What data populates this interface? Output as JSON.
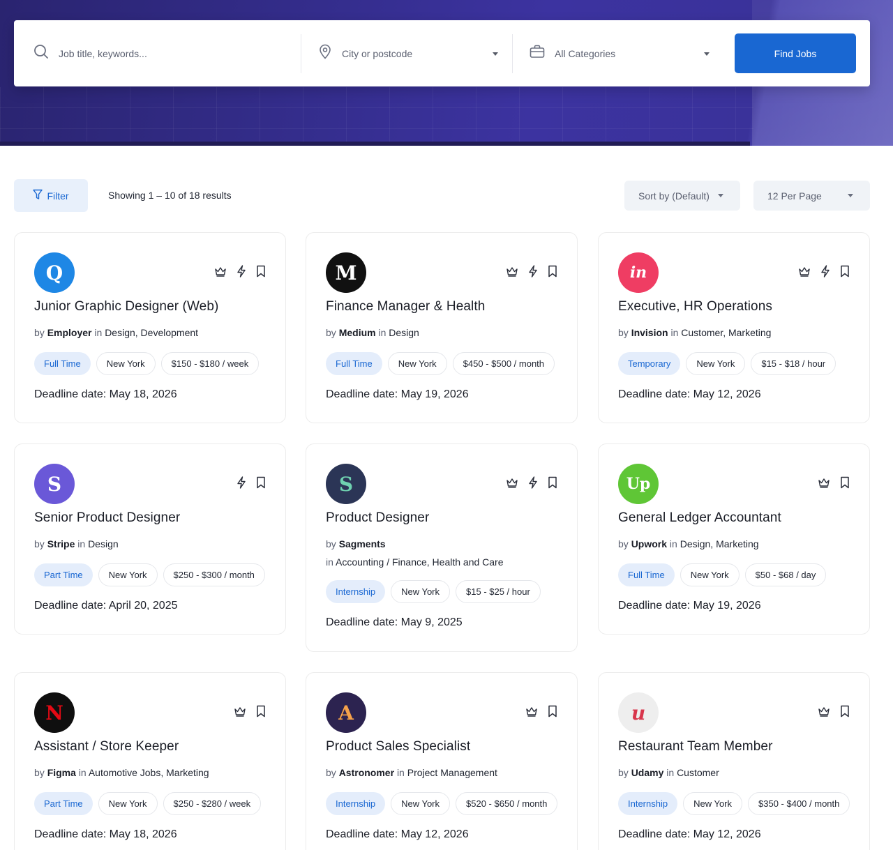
{
  "search": {
    "keyword_placeholder": "Job title, keywords...",
    "city_placeholder": "City or postcode",
    "category_value": "All Categories",
    "find_button": "Find Jobs"
  },
  "toolbar": {
    "filter_label": "Filter",
    "results_text": "Showing 1 – 10 of 18 results",
    "sort_value": "Sort by (Default)",
    "per_page_value": "12 Per Page"
  },
  "colors": {
    "accent": "#1967d2",
    "tag_bg": "#e4edfb"
  },
  "jobs": [
    {
      "title": "Junior Graphic Designer (Web)",
      "by_label": "by",
      "company": "Employer",
      "in_label": "in",
      "categories": "Design, Development",
      "type": "Full Time",
      "location": "New York",
      "salary": "$150 - $180 / week",
      "deadline": "Deadline date: May 18, 2026",
      "logo": {
        "icon": "employer-logo",
        "text": "Q",
        "bg": "#1e87e5",
        "color": "#ffffff"
      },
      "badges": [
        "crown-icon",
        "lightning-icon",
        "bookmark-icon"
      ]
    },
    {
      "title": "Finance Manager & Health",
      "by_label": "by",
      "company": "Medium",
      "in_label": "in",
      "categories": "Design",
      "type": "Full Time",
      "location": "New York",
      "salary": "$450 - $500 / month",
      "deadline": "Deadline date: May 19, 2026",
      "logo": {
        "icon": "medium-logo",
        "text": "M",
        "bg": "#111111",
        "color": "#ffffff"
      },
      "badges": [
        "crown-icon",
        "lightning-icon",
        "bookmark-icon"
      ]
    },
    {
      "title": "Executive, HR Operations",
      "by_label": "by",
      "company": "Invision",
      "in_label": "in",
      "categories": "Customer, Marketing",
      "type": "Temporary",
      "location": "New York",
      "salary": "$15 - $18 / hour",
      "deadline": "Deadline date: May 12, 2026",
      "logo": {
        "icon": "invision-logo",
        "text": "in",
        "bg": "#ef3d63",
        "color": "#ffffff"
      },
      "badges": [
        "crown-icon",
        "lightning-icon",
        "bookmark-icon"
      ]
    },
    {
      "title": "Senior Product Designer",
      "by_label": "by",
      "company": "Stripe",
      "in_label": "in",
      "categories": "Design",
      "type": "Part Time",
      "location": "New York",
      "salary": "$250 - $300 / month",
      "deadline": "Deadline date: April 20, 2025",
      "logo": {
        "icon": "stripe-logo",
        "text": "S",
        "bg": "#6a58d8",
        "color": "#ffffff"
      },
      "badges": [
        "lightning-icon",
        "bookmark-icon"
      ]
    },
    {
      "title": "Product Designer",
      "by_label": "by",
      "company": "Sagments",
      "in_label": "in",
      "categories": "Accounting / Finance, Health and Care",
      "type": "Internship",
      "location": "New York",
      "salary": "$15 - $25 / hour",
      "deadline": "Deadline date: May 9, 2025",
      "logo": {
        "icon": "sagments-logo",
        "text": "S",
        "bg": "#2b3556",
        "color": "#6fd1b0"
      },
      "badges": [
        "crown-icon",
        "lightning-icon",
        "bookmark-icon"
      ]
    },
    {
      "title": "General Ledger Accountant",
      "by_label": "by",
      "company": "Upwork",
      "in_label": "in",
      "categories": "Design, Marketing",
      "type": "Full Time",
      "location": "New York",
      "salary": "$50 - $68 / day",
      "deadline": "Deadline date: May 19, 2026",
      "logo": {
        "icon": "upwork-logo",
        "text": "Up",
        "bg": "#5fc636",
        "color": "#ffffff"
      },
      "badges": [
        "crown-icon",
        "bookmark-icon"
      ]
    },
    {
      "title": "Assistant / Store Keeper",
      "by_label": "by",
      "company": "Figma",
      "in_label": "in",
      "categories": "Automotive Jobs, Marketing",
      "type": "Part Time",
      "location": "New York",
      "salary": "$250 - $280 / week",
      "deadline": "Deadline date: May 18, 2026",
      "logo": {
        "icon": "netflix-logo",
        "text": "N",
        "bg": "#0f0f0f",
        "color": "#e50914"
      },
      "badges": [
        "crown-icon",
        "bookmark-icon"
      ]
    },
    {
      "title": "Product Sales Specialist",
      "by_label": "by",
      "company": "Astronomer",
      "in_label": "in",
      "categories": "Project Management",
      "type": "Internship",
      "location": "New York",
      "salary": "$520 - $650 / month",
      "deadline": "Deadline date: May 12, 2026",
      "logo": {
        "icon": "astronomer-logo",
        "text": "A",
        "bg": "#2c2350",
        "color": "#f6a24a"
      },
      "badges": [
        "crown-icon",
        "bookmark-icon"
      ]
    },
    {
      "title": "Restaurant Team Member",
      "by_label": "by",
      "company": "Udamy",
      "in_label": "in",
      "categories": "Customer",
      "type": "Internship",
      "location": "New York",
      "salary": "$350 - $400 / month",
      "deadline": "Deadline date: May 12, 2026",
      "logo": {
        "icon": "udemy-logo",
        "text": "u",
        "bg": "#eeeeee",
        "color": "#d8364c"
      },
      "badges": [
        "crown-icon",
        "bookmark-icon"
      ]
    }
  ]
}
